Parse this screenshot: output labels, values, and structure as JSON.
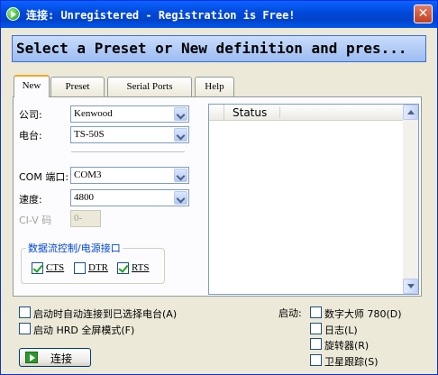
{
  "window": {
    "title": "连接: Unregistered - Registration is Free!",
    "close_symbol": "✕"
  },
  "banner": {
    "text": "Select a Preset or New definition and pres..."
  },
  "tabs": [
    {
      "label": "New",
      "active": true
    },
    {
      "label": "Preset",
      "active": false
    },
    {
      "label": "Serial Ports",
      "active": false
    },
    {
      "label": "Help",
      "active": false
    }
  ],
  "form": {
    "company_label": "公司:",
    "company_value": "Kenwood",
    "radio_label": "电台:",
    "radio_value": "TS-50S",
    "com_label": "COM 端口:",
    "com_value": "COM3",
    "speed_label": "速度:",
    "speed_value": "4800",
    "civ_label": "CI-V 码",
    "civ_value": "0-",
    "flow_group_title": "数据流控制/电源接口",
    "flow_options": [
      {
        "label": "CTS",
        "checked": true
      },
      {
        "label": "DTR",
        "checked": false
      },
      {
        "label": "RTS",
        "checked": true
      }
    ]
  },
  "status_panel": {
    "column_header": "Status"
  },
  "options": {
    "auto_connect_label": "启动时自动连接到已选择电台(A)",
    "auto_connect_checked": false,
    "fullscreen_label": "启动 HRD 全屏模式(F)",
    "fullscreen_checked": false,
    "startup_label": "启动:",
    "startup_items": [
      {
        "label": "数字大师 780(D)",
        "checked": false
      },
      {
        "label": "日志(L)",
        "checked": false
      },
      {
        "label": "旋转器(R)",
        "checked": false
      },
      {
        "label": "卫星跟踪(S)",
        "checked": false
      }
    ]
  },
  "connect_button": {
    "label": "连接"
  },
  "colors": {
    "title_bar": "#0148d8",
    "banner_bg": "#b7cff6",
    "group_title": "#0046d5",
    "tab_highlight": "#f5a623"
  }
}
